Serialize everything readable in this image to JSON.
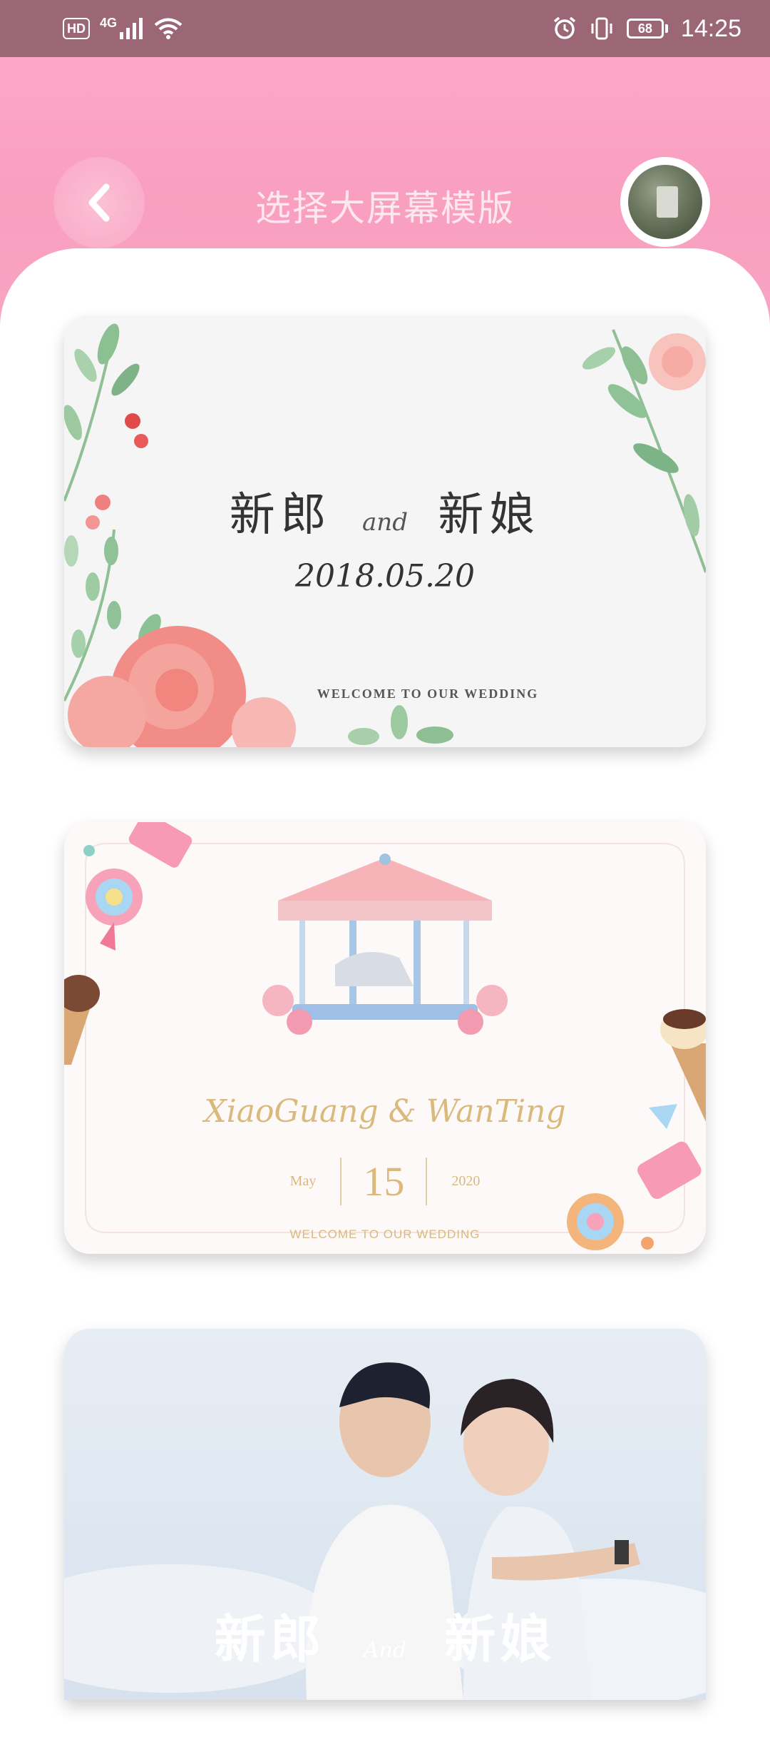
{
  "status_bar": {
    "hd_label": "HD",
    "network_label": "4G",
    "battery_level": "68",
    "time": "14:25",
    "icons": [
      "signal-icon",
      "wifi-icon",
      "alarm-icon",
      "vibrate-icon",
      "battery-icon"
    ]
  },
  "header": {
    "title": "选择大屏幕模版",
    "back_icon": "chevron-left-icon",
    "avatar": "user-avatar"
  },
  "templates": [
    {
      "groom": "新郎",
      "and": "and",
      "bride": "新娘",
      "date": "2018.05.20",
      "welcome": "WELCOME TO OUR WEDDING"
    },
    {
      "names": "XiaoGuang & WanTing",
      "month": "May",
      "day": "15",
      "year": "2020",
      "welcome": "WELCOME TO OUR WEDDING"
    },
    {
      "groom": "新郎",
      "and": "And",
      "bride": "新娘"
    }
  ],
  "colors": {
    "status_bar": "#9b6676",
    "header_pink": "#fda7c7",
    "gold_text": "#d9b97c"
  }
}
